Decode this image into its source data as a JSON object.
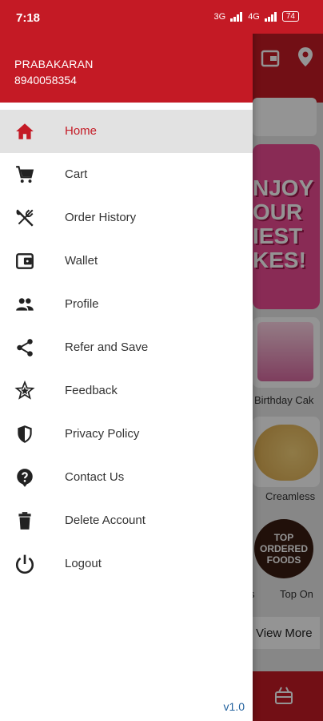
{
  "status_bar": {
    "time": "7:18",
    "network": "3G",
    "network2": "4G",
    "battery": "74"
  },
  "drawer": {
    "user_name": "PRABAKARAN",
    "user_phone": "8940058354",
    "version": "v1.0",
    "items": [
      {
        "label": "Home",
        "icon": "home-icon"
      },
      {
        "label": "Cart",
        "icon": "cart-icon"
      },
      {
        "label": "Order History",
        "icon": "fork-knife-icon"
      },
      {
        "label": "Wallet",
        "icon": "wallet-icon"
      },
      {
        "label": "Profile",
        "icon": "people-icon"
      },
      {
        "label": "Refer and Save",
        "icon": "share-icon"
      },
      {
        "label": "Feedback",
        "icon": "feedback-star-icon"
      },
      {
        "label": "Privacy Policy",
        "icon": "shield-icon"
      },
      {
        "label": "Contact Us",
        "icon": "help-icon"
      },
      {
        "label": "Delete Account",
        "icon": "trash-icon"
      },
      {
        "label": "Logout",
        "icon": "power-icon"
      }
    ]
  },
  "background": {
    "banner_text": "NJOY OUR IEST KES!",
    "card1_label": "Birthday Cak",
    "card2_label": "Creamless",
    "badge_text": "TOP ORDERED FOODS",
    "card3_label_left": "s",
    "card3_label": "Top On",
    "view_more": "View More"
  },
  "colors": {
    "brand": "#c41a25",
    "active_bg": "#e2e2e2",
    "version": "#1f5f9c"
  }
}
